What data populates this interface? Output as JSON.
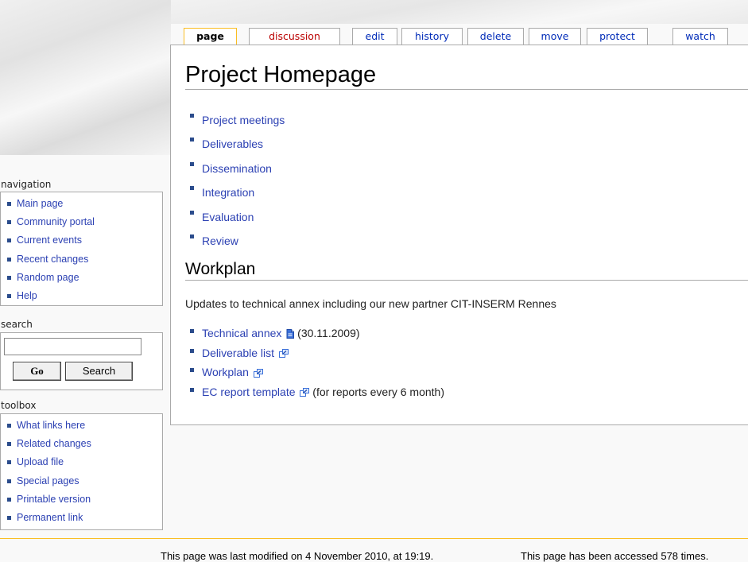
{
  "tabs": [
    {
      "label": "page",
      "state": "selected"
    },
    {
      "label": "discussion",
      "state": "new"
    },
    {
      "label": "edit"
    },
    {
      "label": "history"
    },
    {
      "label": "delete"
    },
    {
      "label": "move"
    },
    {
      "label": "protect"
    },
    {
      "label": "watch"
    }
  ],
  "main": {
    "title": "Project Homepage",
    "project_links": [
      "Project meetings",
      "Deliverables",
      "Dissemination",
      "Integration",
      "Evaluation",
      "Review"
    ],
    "workplan": {
      "heading": "Workplan",
      "intro": "Updates to technical annex including our new partner CIT-INSERM Rennes",
      "items": [
        {
          "link": "Technical annex",
          "icon": "document-icon",
          "suffix": " (30.11.2009)"
        },
        {
          "link": "Deliverable list",
          "icon": "external-link-icon",
          "suffix": ""
        },
        {
          "link": "Workplan",
          "icon": "external-link-icon",
          "suffix": ""
        },
        {
          "link": "EC report template",
          "icon": "external-link-icon",
          "suffix": " (for reports every 6 month)"
        }
      ]
    }
  },
  "sidebar": {
    "navigation": {
      "title": "navigation",
      "items": [
        "Main page",
        "Community portal",
        "Current events",
        "Recent changes",
        "Random page",
        "Help"
      ]
    },
    "search": {
      "title": "search",
      "input_value": "",
      "go_label": "Go",
      "search_label": "Search"
    },
    "toolbox": {
      "title": "toolbox",
      "items": [
        "What links here",
        "Related changes",
        "Upload file",
        "Special pages",
        "Printable version",
        "Permanent link"
      ]
    }
  },
  "footer": {
    "last_modified": "This page was last modified on 4 November 2010, at 19:19.",
    "views": "This page has been accessed 578 times."
  },
  "colors": {
    "link": "#2c41b3",
    "new_link": "#ba0000",
    "selected_tab_border": "#fabd23",
    "border": "#aaaaaa"
  }
}
